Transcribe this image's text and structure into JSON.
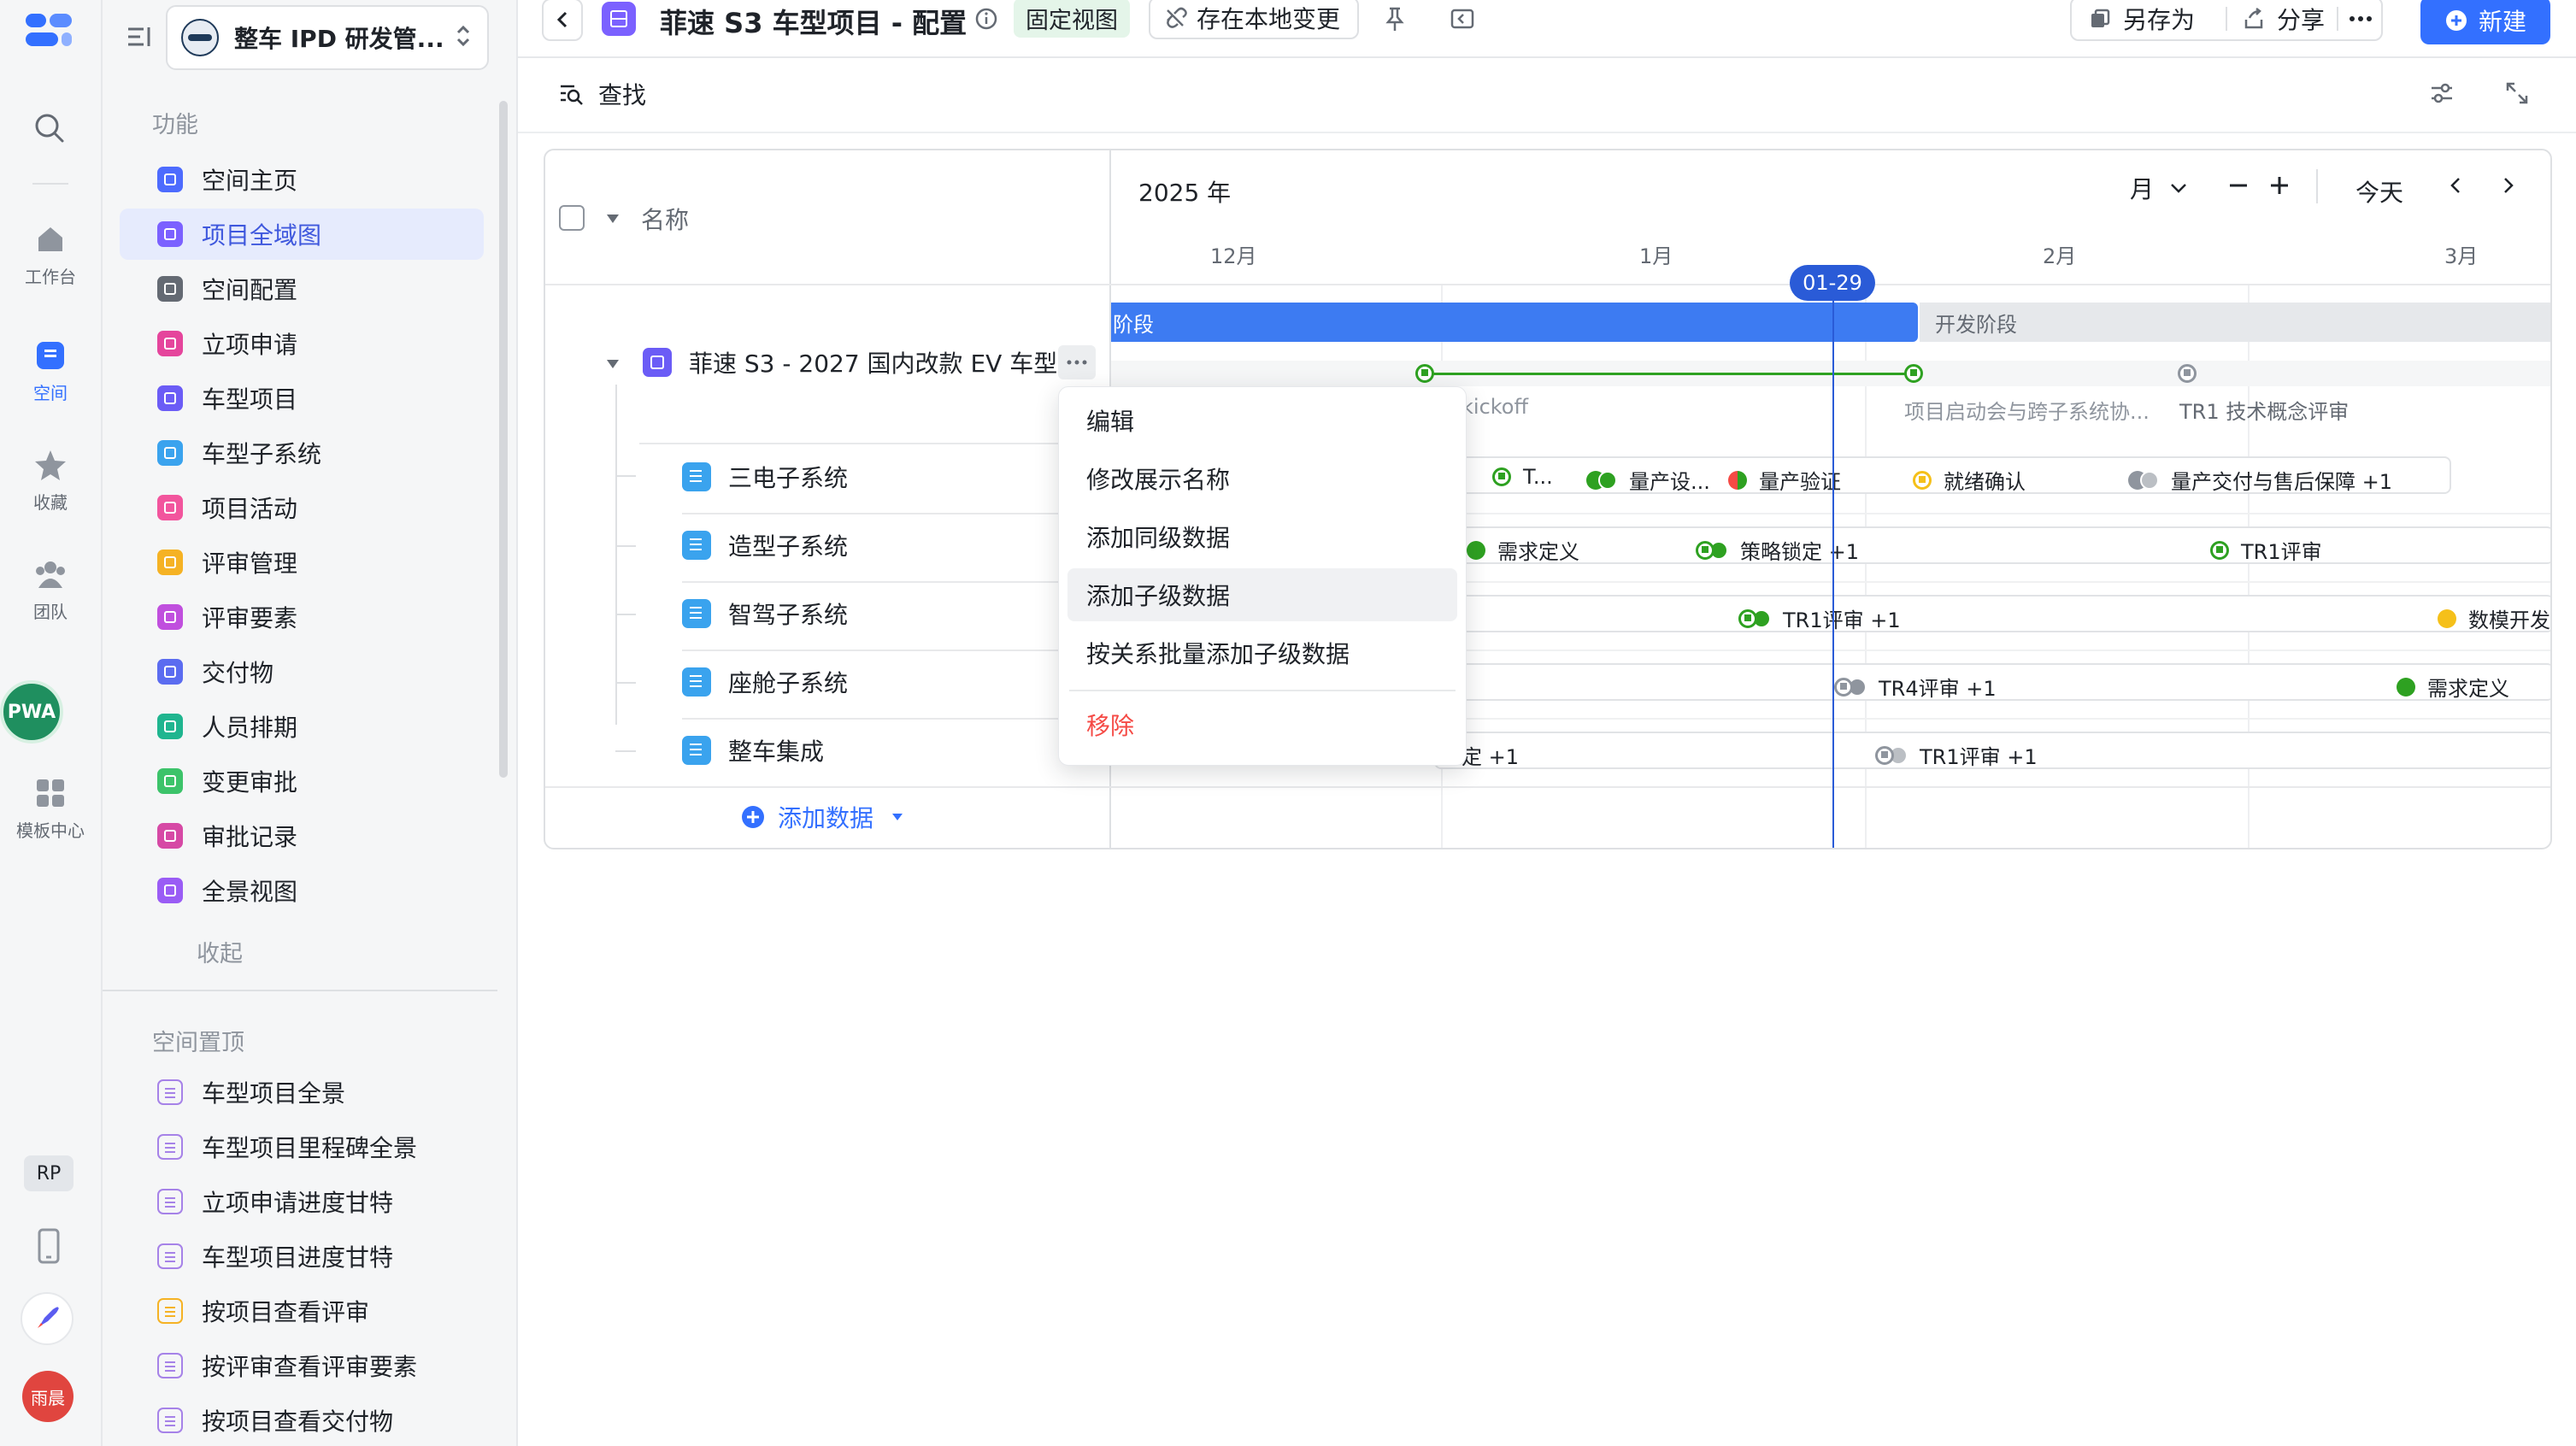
{
  "rail": {
    "items": [
      {
        "label": "工作台"
      },
      {
        "label": "空间"
      },
      {
        "label": "收藏"
      },
      {
        "label": "团队"
      },
      {
        "label": "模板中心"
      }
    ],
    "pwa_badge": "PWA",
    "rp_badge": "RP",
    "user_avatar": "雨晨"
  },
  "sidebar": {
    "workspace_name": "整车 IPD 研发管...",
    "section_features": "功能",
    "items": [
      {
        "label": "空间主页",
        "color": "#4d6bfe"
      },
      {
        "label": "项目全域图",
        "color": "#7b61ff"
      },
      {
        "label": "空间配置",
        "color": "#646a73"
      },
      {
        "label": "立项申请",
        "color": "#e5459c"
      },
      {
        "label": "车型项目",
        "color": "#6b5cf6"
      },
      {
        "label": "车型子系统",
        "color": "#3aa3ee"
      },
      {
        "label": "项目活动",
        "color": "#f2559d"
      },
      {
        "label": "评审管理",
        "color": "#f5b224"
      },
      {
        "label": "评审要素",
        "color": "#c04fde"
      },
      {
        "label": "交付物",
        "color": "#5b6cf0"
      },
      {
        "label": "人员排期",
        "color": "#1fb58f"
      },
      {
        "label": "变更审批",
        "color": "#3cc36a"
      },
      {
        "label": "审批记录",
        "color": "#d649a5"
      },
      {
        "label": "全景视图",
        "color": "#9a5cf5"
      }
    ],
    "collapse_label": "收起",
    "section_pinned": "空间置顶",
    "pinned": [
      {
        "label": "车型项目全景",
        "color": "#a682e8"
      },
      {
        "label": "车型项目里程碑全景",
        "color": "#a682e8"
      },
      {
        "label": "立项申请进度甘特",
        "color": "#a682e8"
      },
      {
        "label": "车型项目进度甘特",
        "color": "#a682e8"
      },
      {
        "label": "按项目查看评审",
        "color": "#f5b224"
      },
      {
        "label": "按评审查看评审要素",
        "color": "#a682e8"
      },
      {
        "label": "按项目查看交付物",
        "color": "#a682e8"
      }
    ]
  },
  "header": {
    "title": "菲速 S3 车型项目 - 配置",
    "fixed_view_tag": "固定视图",
    "local_changes": "存在本地变更",
    "save_as": "另存为",
    "share": "分享",
    "new": "新建"
  },
  "toolbar": {
    "find": "查找"
  },
  "gantt": {
    "name_column": "名称",
    "year": "2025 年",
    "scale": "月",
    "today": "今天",
    "months": [
      "12月",
      "1月",
      "2月",
      "3月"
    ],
    "today_marker": "01-29",
    "parent_row": "菲速 S3 - 2027 国内改款 EV 车型",
    "phase_current": "阶段",
    "phase_next": "开发阶段",
    "parent_milestones": [
      "kickoff",
      "项目启动会与跨子系统协...",
      "TR1 技术概念评审"
    ],
    "children": [
      "三电子系统",
      "造型子系统",
      "智驾子系统",
      "座舱子系统",
      "整车集成"
    ],
    "add_data": "添加数据",
    "milestones": {
      "row1": [
        "T...",
        "量产设...",
        "量产验证",
        "就绪确认",
        "量产交付与售后保障 +1"
      ],
      "row2": [
        "需求定义",
        "策略锁定 +1",
        "TR1评审"
      ],
      "row3": [
        "TR1评审 +1",
        "数模开发"
      ],
      "row4": [
        "TR4评审 +1",
        "需求定义"
      ],
      "row5": [
        "定 +1",
        "TR1评审 +1"
      ]
    }
  },
  "context_menu": {
    "items": [
      "编辑",
      "修改展示名称",
      "添加同级数据",
      "添加子级数据",
      "按关系批量添加子级数据"
    ],
    "remove": "移除"
  },
  "colors": {
    "accent": "#3370ff",
    "today_line": "#2a5bd7",
    "phase_bar": "#3d7bf2",
    "milestone_green": "#2ea121",
    "milestone_yellow": "#f5c01a",
    "milestone_red": "#f54a45",
    "milestone_gray": "#8f959e",
    "danger": "#f54a45"
  }
}
